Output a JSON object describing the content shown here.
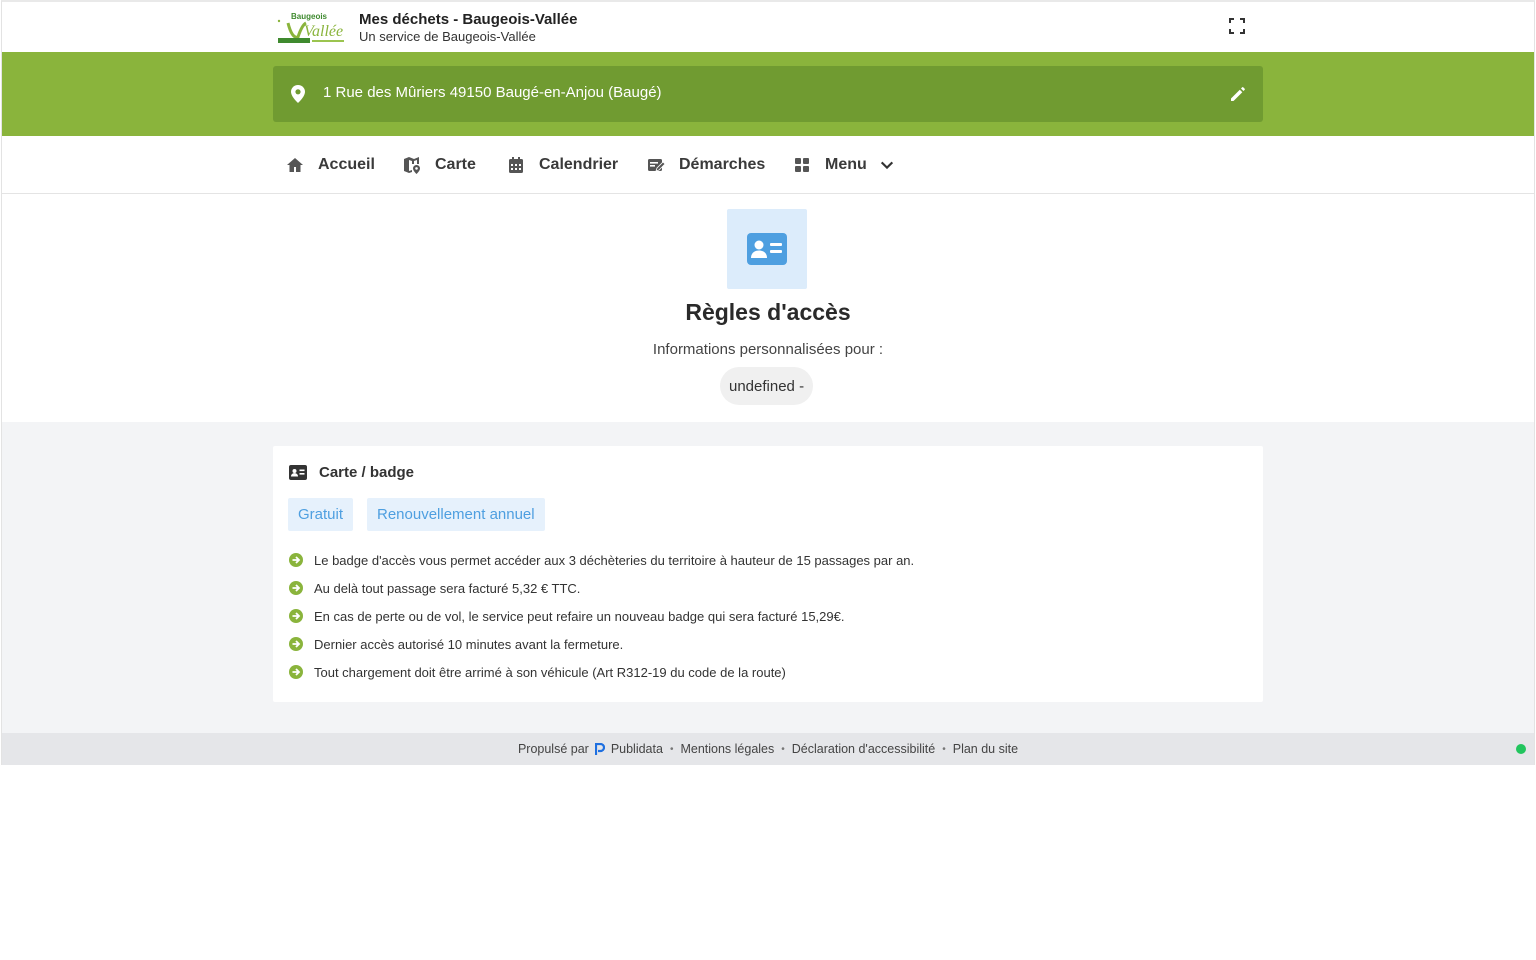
{
  "header": {
    "title": "Mes déchets - Baugeois-Vallée",
    "subtitle": "Un service de Baugeois-Vallée",
    "logo_text": "Baugeois Vallée",
    "fullscreen_icon": "fullscreen-icon"
  },
  "address": {
    "text": "1 Rue des Mûriers 49150 Baugé-en-Anjou (Baugé)",
    "pin_icon": "map-pin-icon",
    "edit_icon": "pencil-icon"
  },
  "nav": {
    "items": [
      {
        "label": "Accueil",
        "icon": "home-icon"
      },
      {
        "label": "Carte",
        "icon": "map-icon"
      },
      {
        "label": "Calendrier",
        "icon": "calendar-icon"
      },
      {
        "label": "Démarches",
        "icon": "form-icon"
      },
      {
        "label": "Menu",
        "icon": "grid-icon"
      }
    ]
  },
  "page": {
    "title": "Règles d'accès",
    "subtitle": "Informations personnalisées pour :",
    "chip": "undefined -"
  },
  "card": {
    "title": "Carte / badge",
    "tags": [
      "Gratuit",
      "Renouvellement annuel"
    ],
    "rules": [
      "Le badge d'accès vous permet accéder aux 3 déchèteries du territoire à hauteur de 15 passages par an.",
      "Au delà tout passage sera facturé 5,32 € TTC.",
      "En cas de perte ou de vol, le service peut refaire un nouveau badge qui sera facturé 15,29€.",
      "Dernier accès autorisé 10 minutes avant la fermeture.",
      "Tout chargement doit être arrimé à son véhicule (Art R312-19 du code de la route)"
    ]
  },
  "footer": {
    "powered_by": "Propulsé par",
    "brand": "Publidata",
    "links": [
      "Mentions légales",
      "Déclaration d'accessibilité",
      "Plan du site"
    ]
  },
  "colors": {
    "green": "#8ab43c",
    "green_dark": "#709b31",
    "blue": "#4e9fe0",
    "status": "#22c55e"
  }
}
